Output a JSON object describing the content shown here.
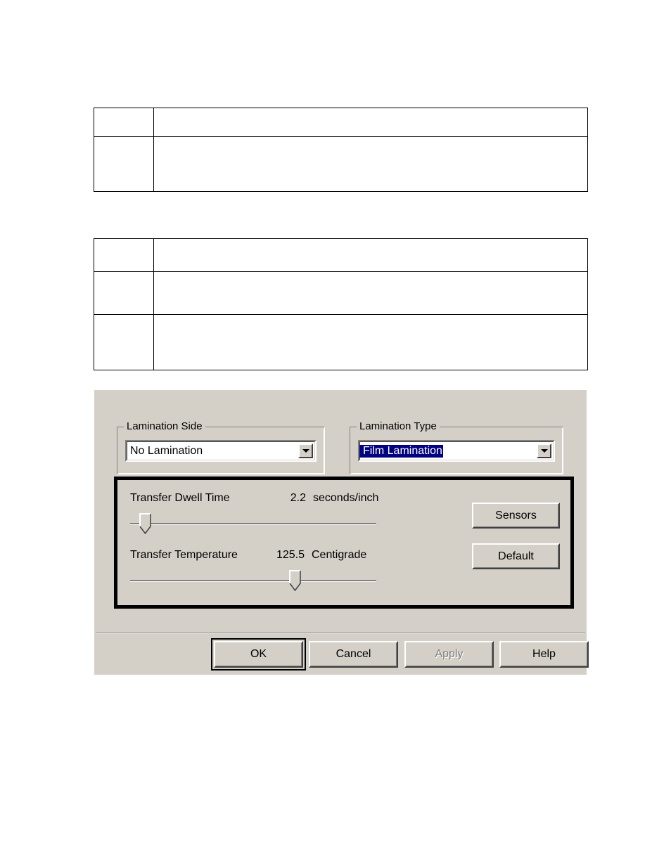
{
  "document": {
    "tables": [
      {
        "name": "table-one",
        "rows": [
          {
            "cells": [
              "",
              ""
            ],
            "height_class": "h-row-1"
          },
          {
            "cells": [
              "",
              ""
            ],
            "height_class": "h-row-2"
          }
        ]
      },
      {
        "name": "table-two",
        "rows": [
          {
            "cells": [
              "",
              ""
            ],
            "height_class": "h-row-3"
          },
          {
            "cells": [
              "",
              ""
            ],
            "height_class": "h-row-4"
          },
          {
            "cells": [
              "",
              ""
            ],
            "height_class": "h-row-5"
          }
        ]
      }
    ]
  },
  "dialog": {
    "lamination_side": {
      "group_label": "Lamination Side",
      "combo_value": "No Lamination",
      "combo_selected": false,
      "arrow_icon": "chevron-down-icon"
    },
    "lamination_type": {
      "group_label": "Lamination Type",
      "combo_value": "Film Lamination",
      "combo_selected": true,
      "arrow_icon": "chevron-down-icon"
    },
    "transfer_panel": {
      "dwell": {
        "label": "Transfer Dwell Time",
        "value": "2.2",
        "unit": "seconds/inch",
        "thumb_percent": 6
      },
      "temperature": {
        "label": "Transfer Temperature",
        "value": "125.5",
        "unit": "Centigrade",
        "thumb_percent": 67
      },
      "buttons": {
        "sensors": "Sensors",
        "default": "Default"
      }
    },
    "footer": {
      "ok": "OK",
      "cancel": "Cancel",
      "apply": "Apply",
      "apply_disabled": true,
      "help": "Help"
    }
  },
  "colors": {
    "dialog_face": "#d4d0c8",
    "selection_blue": "#000080",
    "panel_border": "#000000",
    "disabled_text": "#808080",
    "page_background": "#ffffff"
  }
}
